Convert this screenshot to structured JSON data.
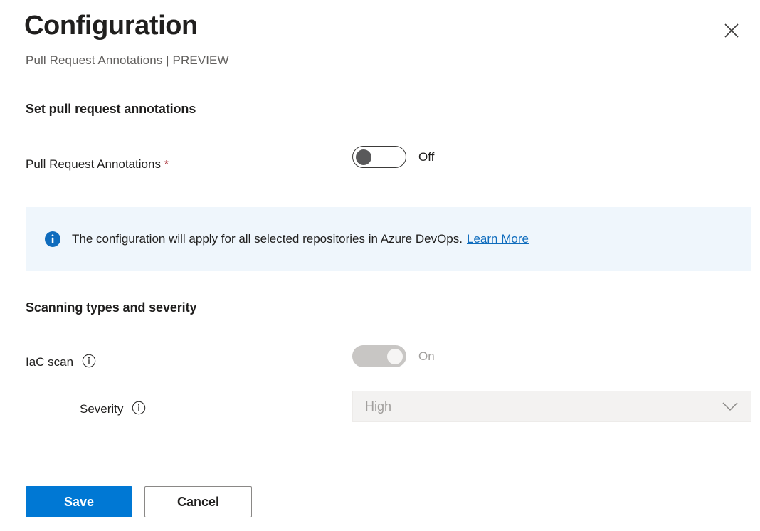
{
  "header": {
    "title": "Configuration",
    "subtitle": "Pull Request Annotations | PREVIEW",
    "close_icon": "close-icon"
  },
  "sections": {
    "set_annotations": {
      "heading": "Set pull request annotations",
      "field": {
        "label": "Pull Request Annotations",
        "required_marker": "*",
        "toggle_state_label": "Off",
        "toggle_on": false
      }
    },
    "scanning": {
      "heading": "Scanning types and severity",
      "iac_scan": {
        "label": "IaC scan",
        "info_icon": "info-circle-icon",
        "toggle_state_label": "On",
        "toggle_on": true,
        "disabled": true
      },
      "severity": {
        "label": "Severity",
        "info_icon": "info-circle-icon",
        "selected_value": "High",
        "chevron_icon": "chevron-down-icon",
        "disabled": true
      }
    }
  },
  "info_banner": {
    "icon": "info-filled-icon",
    "message": "The configuration will apply for all selected repositories in Azure DevOps.",
    "link_label": "Learn More",
    "background_color": "#eff6fc",
    "icon_color": "#0f6cbd"
  },
  "footer": {
    "save_label": "Save",
    "cancel_label": "Cancel",
    "primary_color": "#0078d4"
  }
}
